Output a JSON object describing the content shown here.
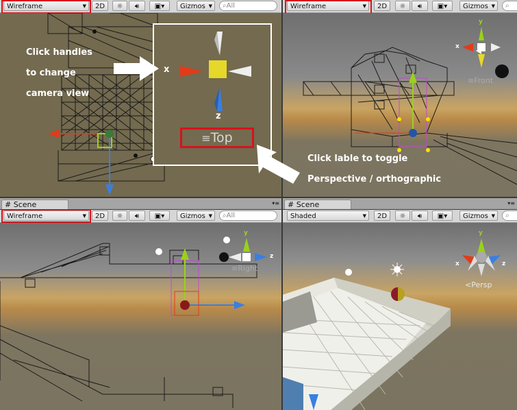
{
  "toolbar_common": {
    "btn_2d": "2D",
    "gizmos": "Gizmos",
    "search_placeholder": "All",
    "sun_icon": "sun-icon",
    "audio_icon": "speaker-icon",
    "image_icon": "image-icon"
  },
  "panels": {
    "top_left": {
      "mode": "Wireframe"
    },
    "top_right": {
      "mode": "Wireframe",
      "label": "Front",
      "axis_x": "x",
      "axis_y": "y"
    },
    "bottom_left": {
      "tab": "Scene",
      "mode": "Wireframe",
      "label": "Right",
      "axis_y": "y",
      "axis_z": "z"
    },
    "bottom_right": {
      "tab": "Scene",
      "mode": "Shaded",
      "label": "Persp",
      "axis_y": "y",
      "axis_x": "x",
      "axis_z": "z"
    }
  },
  "annotations": {
    "handles_line1": "Click handles",
    "handles_line2": "to change",
    "handles_line3": "camera view",
    "label_line1": "Click lable to toggle",
    "label_line2": "Perspective / orthographic",
    "zoom_axis_x": "x",
    "zoom_axis_z": "z",
    "zoom_label": "Top"
  },
  "colors": {
    "highlight": "#d8121b",
    "axis_x": "#e23b1a",
    "axis_y": "#9ad11c",
    "axis_z": "#3a7fe0"
  }
}
